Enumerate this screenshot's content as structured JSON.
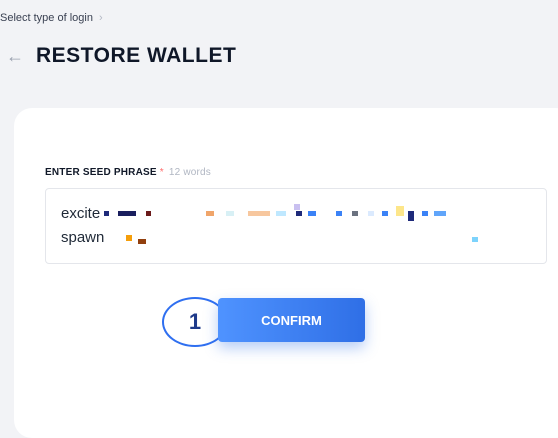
{
  "breadcrumb": {
    "label": "Select type of login"
  },
  "header": {
    "title": "RESTORE WALLET"
  },
  "seed": {
    "label": "ENTER SEED PHRASE",
    "required_mark": "*",
    "word_count": "12 words",
    "line1_first_word": "excite",
    "line2_first_word": "spawn"
  },
  "step": {
    "number": "1"
  },
  "actions": {
    "confirm_label": "CONFIRM"
  },
  "colors": {
    "accent": "#2f6fe6",
    "title": "#0f1728",
    "background": "#f2f3f6"
  }
}
